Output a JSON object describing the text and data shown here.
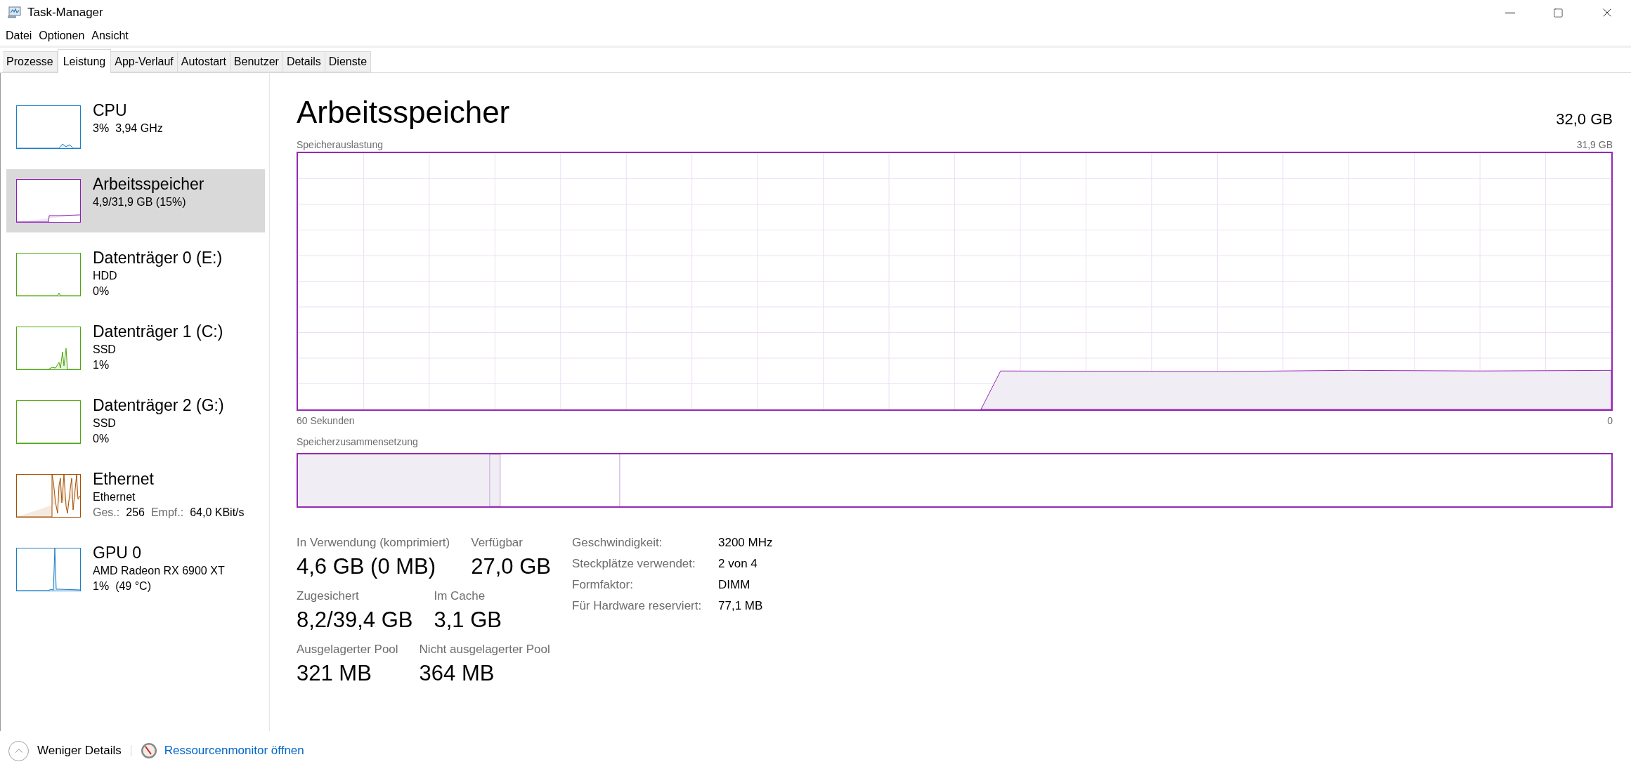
{
  "window": {
    "title": "Task-Manager"
  },
  "menu": [
    "Datei",
    "Optionen",
    "Ansicht"
  ],
  "tabs": [
    {
      "label": "Prozesse",
      "selected": false
    },
    {
      "label": "Leistung",
      "selected": true
    },
    {
      "label": "App-Verlauf",
      "selected": false
    },
    {
      "label": "Autostart",
      "selected": false
    },
    {
      "label": "Benutzer",
      "selected": false
    },
    {
      "label": "Details",
      "selected": false
    },
    {
      "label": "Dienste",
      "selected": false
    }
  ],
  "sidebar": {
    "items": [
      {
        "title": "CPU",
        "lines": [
          [
            "3%",
            "3,94 GHz"
          ]
        ],
        "color": "#1a7fc9",
        "selected": false
      },
      {
        "title": "Arbeitsspeicher",
        "lines": [
          [
            "4,9/31,9 GB (15%)"
          ]
        ],
        "color": "#8b1fb8",
        "selected": true
      },
      {
        "title": "Datenträger 0 (E:)",
        "lines": [
          [
            "HDD"
          ],
          [
            "0%"
          ]
        ],
        "color": "#4ca60c",
        "selected": false
      },
      {
        "title": "Datenträger 1 (C:)",
        "lines": [
          [
            "SSD"
          ],
          [
            "1%"
          ]
        ],
        "color": "#4ca60c",
        "selected": false
      },
      {
        "title": "Datenträger 2 (G:)",
        "lines": [
          [
            "SSD"
          ],
          [
            "0%"
          ]
        ],
        "color": "#4ca60c",
        "selected": false
      },
      {
        "title": "Ethernet",
        "lines": [
          [
            "Ethernet"
          ]
        ],
        "stats": [
          {
            "label": "Ges.:",
            "value": "256"
          },
          {
            "label": "Empf.:",
            "value": "64,0 KBit/s"
          }
        ],
        "color": "#a74f01",
        "selected": false
      },
      {
        "title": "GPU 0",
        "lines": [
          [
            "AMD Radeon RX 6900 XT"
          ],
          [
            "1%",
            "(49 °C)"
          ]
        ],
        "color": "#1a7fc9",
        "selected": false
      }
    ]
  },
  "main": {
    "title": "Arbeitsspeicher",
    "total": "32,0 GB",
    "usage_graph": {
      "label": "Speicherauslastung",
      "max": "31,9 GB",
      "time": "60 Sekunden",
      "min": "0"
    },
    "composition": {
      "label": "Speicherzusammensetzung"
    },
    "stats": [
      [
        {
          "label": "In Verwendung (komprimiert)",
          "value": "4,6 GB (0 MB)"
        },
        {
          "label": "Verfügbar",
          "value": "27,0 GB"
        }
      ],
      [
        {
          "label": "Zugesichert",
          "value": "8,2/39,4 GB"
        },
        {
          "label": "Im Cache",
          "value": "3,1 GB"
        }
      ],
      [
        {
          "label": "Ausgelagerter Pool",
          "value": "321 MB"
        },
        {
          "label": "Nicht ausgelagerter Pool",
          "value": "364 MB"
        }
      ]
    ],
    "details": [
      {
        "label": "Geschwindigkeit:",
        "value": "3200 MHz"
      },
      {
        "label": "Steckplätze verwendet:",
        "value": "2 von 4"
      },
      {
        "label": "Formfaktor:",
        "value": "DIMM"
      },
      {
        "label": "Für Hardware reserviert:",
        "value": "77,1 MB"
      }
    ]
  },
  "footer": {
    "less_details": "Weniger Details",
    "resource_monitor": "Ressourcenmonitor öffnen"
  }
}
